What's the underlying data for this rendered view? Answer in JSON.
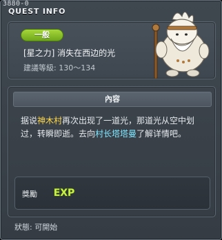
{
  "window": {
    "id": "3880-0",
    "title": "QUEST INFO"
  },
  "quest": {
    "badge": "一般",
    "name": "[星之力] 消失在西边的光",
    "level": "建議等級: 130～134"
  },
  "content": {
    "header": "內容",
    "desc_parts": [
      "据说",
      "神木村",
      "再次出现了一道光，那道光从空中划过，转瞬即逝。去向",
      "村长塔塔曼",
      "了解详情吧。"
    ]
  },
  "reward": {
    "label": "獎勵",
    "icon": "exp-icon",
    "icon_text": "EXP"
  },
  "status": "狀態:  可開始",
  "colors": {
    "badge_green": "#8cc12a",
    "highlight_yellow": "#ffd84a",
    "highlight_cyan": "#7fe6ff"
  }
}
